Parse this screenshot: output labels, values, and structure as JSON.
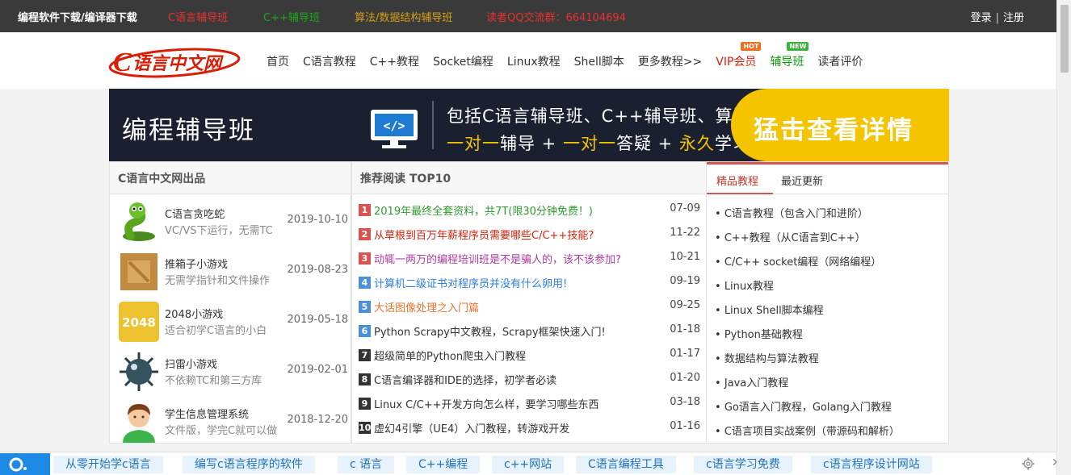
{
  "topbar": {
    "links": [
      {
        "label": "编程软件下载/编译器下载",
        "color": "#ffffff"
      },
      {
        "label": "C语言辅导班",
        "color": "#e8312f"
      },
      {
        "label": "C++辅导班",
        "color": "#1aa81a"
      },
      {
        "label": "算法/数据结构辅导班",
        "color": "#d4a017"
      },
      {
        "label": "读者QQ交流群：664104694",
        "color": "#e8312f"
      }
    ],
    "login": "登录",
    "separator": "|",
    "register": "注册"
  },
  "logo": {
    "text": "C语言中文网"
  },
  "nav": {
    "items": [
      {
        "label": "首页"
      },
      {
        "label": "C语言教程"
      },
      {
        "label": "C++教程"
      },
      {
        "label": "Socket编程"
      },
      {
        "label": "Linux教程"
      },
      {
        "label": "Shell脚本"
      },
      {
        "label": "更多教程>>"
      },
      {
        "label": "VIP会员",
        "badge": "HOT"
      },
      {
        "label": "辅导班",
        "badge": "NEW"
      },
      {
        "label": "读者评价"
      }
    ]
  },
  "banner": {
    "title": "编程辅导班",
    "monitor_code": "</>",
    "line1": "包括C语言辅导班、C++辅导班、算法辅导班",
    "line2_parts": [
      "一对一",
      "辅导 + ",
      "一对一",
      "答疑 + ",
      "永久",
      "学习"
    ],
    "cta": "猛击查看详情"
  },
  "products": {
    "header": "C语言中文网出品",
    "items": [
      {
        "name": "C语言贪吃蛇",
        "desc": "VC/VS下运行，无需TC",
        "date": "2019-10-10",
        "icon": "snake-icon"
      },
      {
        "name": "推箱子小游戏",
        "desc": "无需学指针和文件操作",
        "date": "2019-08-23",
        "icon": "crate-icon"
      },
      {
        "name": "2048小游戏",
        "desc": "适合初学C语言的小白",
        "date": "2019-05-18",
        "icon": "2048-icon",
        "icon_text": "2048"
      },
      {
        "name": "扫雷小游戏",
        "desc": "不依赖TC和第三方库",
        "date": "2019-02-01",
        "icon": "mine-icon"
      },
      {
        "name": "学生信息管理系统",
        "desc": "文件版，学完C就可以做",
        "date": "2018-12-20",
        "icon": "student-icon"
      }
    ]
  },
  "top10": {
    "header": "推荐阅读 TOP10",
    "items": [
      {
        "num": "1",
        "title": "2019年最终全套资料，共7T(限30分钟免费！)",
        "date": "07-09",
        "color": "#2e9a2e",
        "num_bg": "#d9534f"
      },
      {
        "num": "2",
        "title": "从草根到百万年薪程序员需要哪些C/C++技能?",
        "date": "11-22",
        "color": "#d81e06",
        "num_bg": "#d9534f"
      },
      {
        "num": "3",
        "title": "动辄一两万的编程培训班是不是骗人的，该不该参加?",
        "date": "10-21",
        "color": "#b23aa3",
        "num_bg": "#d9534f"
      },
      {
        "num": "4",
        "title": "计算机二级证书对程序员并没有什么卵用!",
        "date": "09-19",
        "color": "#2a7de1",
        "num_bg": "#4a90d9"
      },
      {
        "num": "5",
        "title": "大话图像处理之入门篇",
        "date": "09-25",
        "color": "#e8722f",
        "num_bg": "#4a90d9"
      },
      {
        "num": "6",
        "title": "Python Scrapy中文教程，Scrapy框架快速入门!",
        "date": "01-18",
        "color": "#333333",
        "num_bg": "#4a90d9"
      },
      {
        "num": "7",
        "title": "超级简单的Python爬虫入门教程",
        "date": "01-17",
        "color": "#333333",
        "num_bg": "#333333"
      },
      {
        "num": "8",
        "title": "C语言编译器和IDE的选择，初学者必读",
        "date": "01-20",
        "color": "#333333",
        "num_bg": "#333333"
      },
      {
        "num": "9",
        "title": "Linux C/C++开发方向怎么样，要学习哪些东西",
        "date": "03-18",
        "color": "#333333",
        "num_bg": "#333333"
      },
      {
        "num": "10",
        "title": "虚幻4引擎（UE4）入门教程，转游戏开发",
        "date": "01-16",
        "color": "#333333",
        "num_bg": "#333333"
      }
    ]
  },
  "tutorials": {
    "tabs": [
      {
        "label": "精品教程"
      },
      {
        "label": "最近更新"
      }
    ],
    "items": [
      "C语言教程（包含入门和进阶）",
      "C++教程（从C语言到C++）",
      "C/C++ socket编程（网络编程）",
      "Linux教程",
      "Linux Shell脚本编程",
      "Python基础教程",
      "数据结构与算法教程",
      "Java入门教程",
      "Go语言入门教程，Golang入门教程",
      "C语言项目实战案例（带源码和解析）"
    ]
  },
  "bottombar": {
    "chips": [
      "从零开始学c语言",
      "编写c语言程序的软件",
      "c 语言",
      "C++编程",
      "c++网站",
      "C语言编程工具",
      "c语言学习免费",
      "c语言程序设计网站"
    ],
    "close": "✕"
  }
}
